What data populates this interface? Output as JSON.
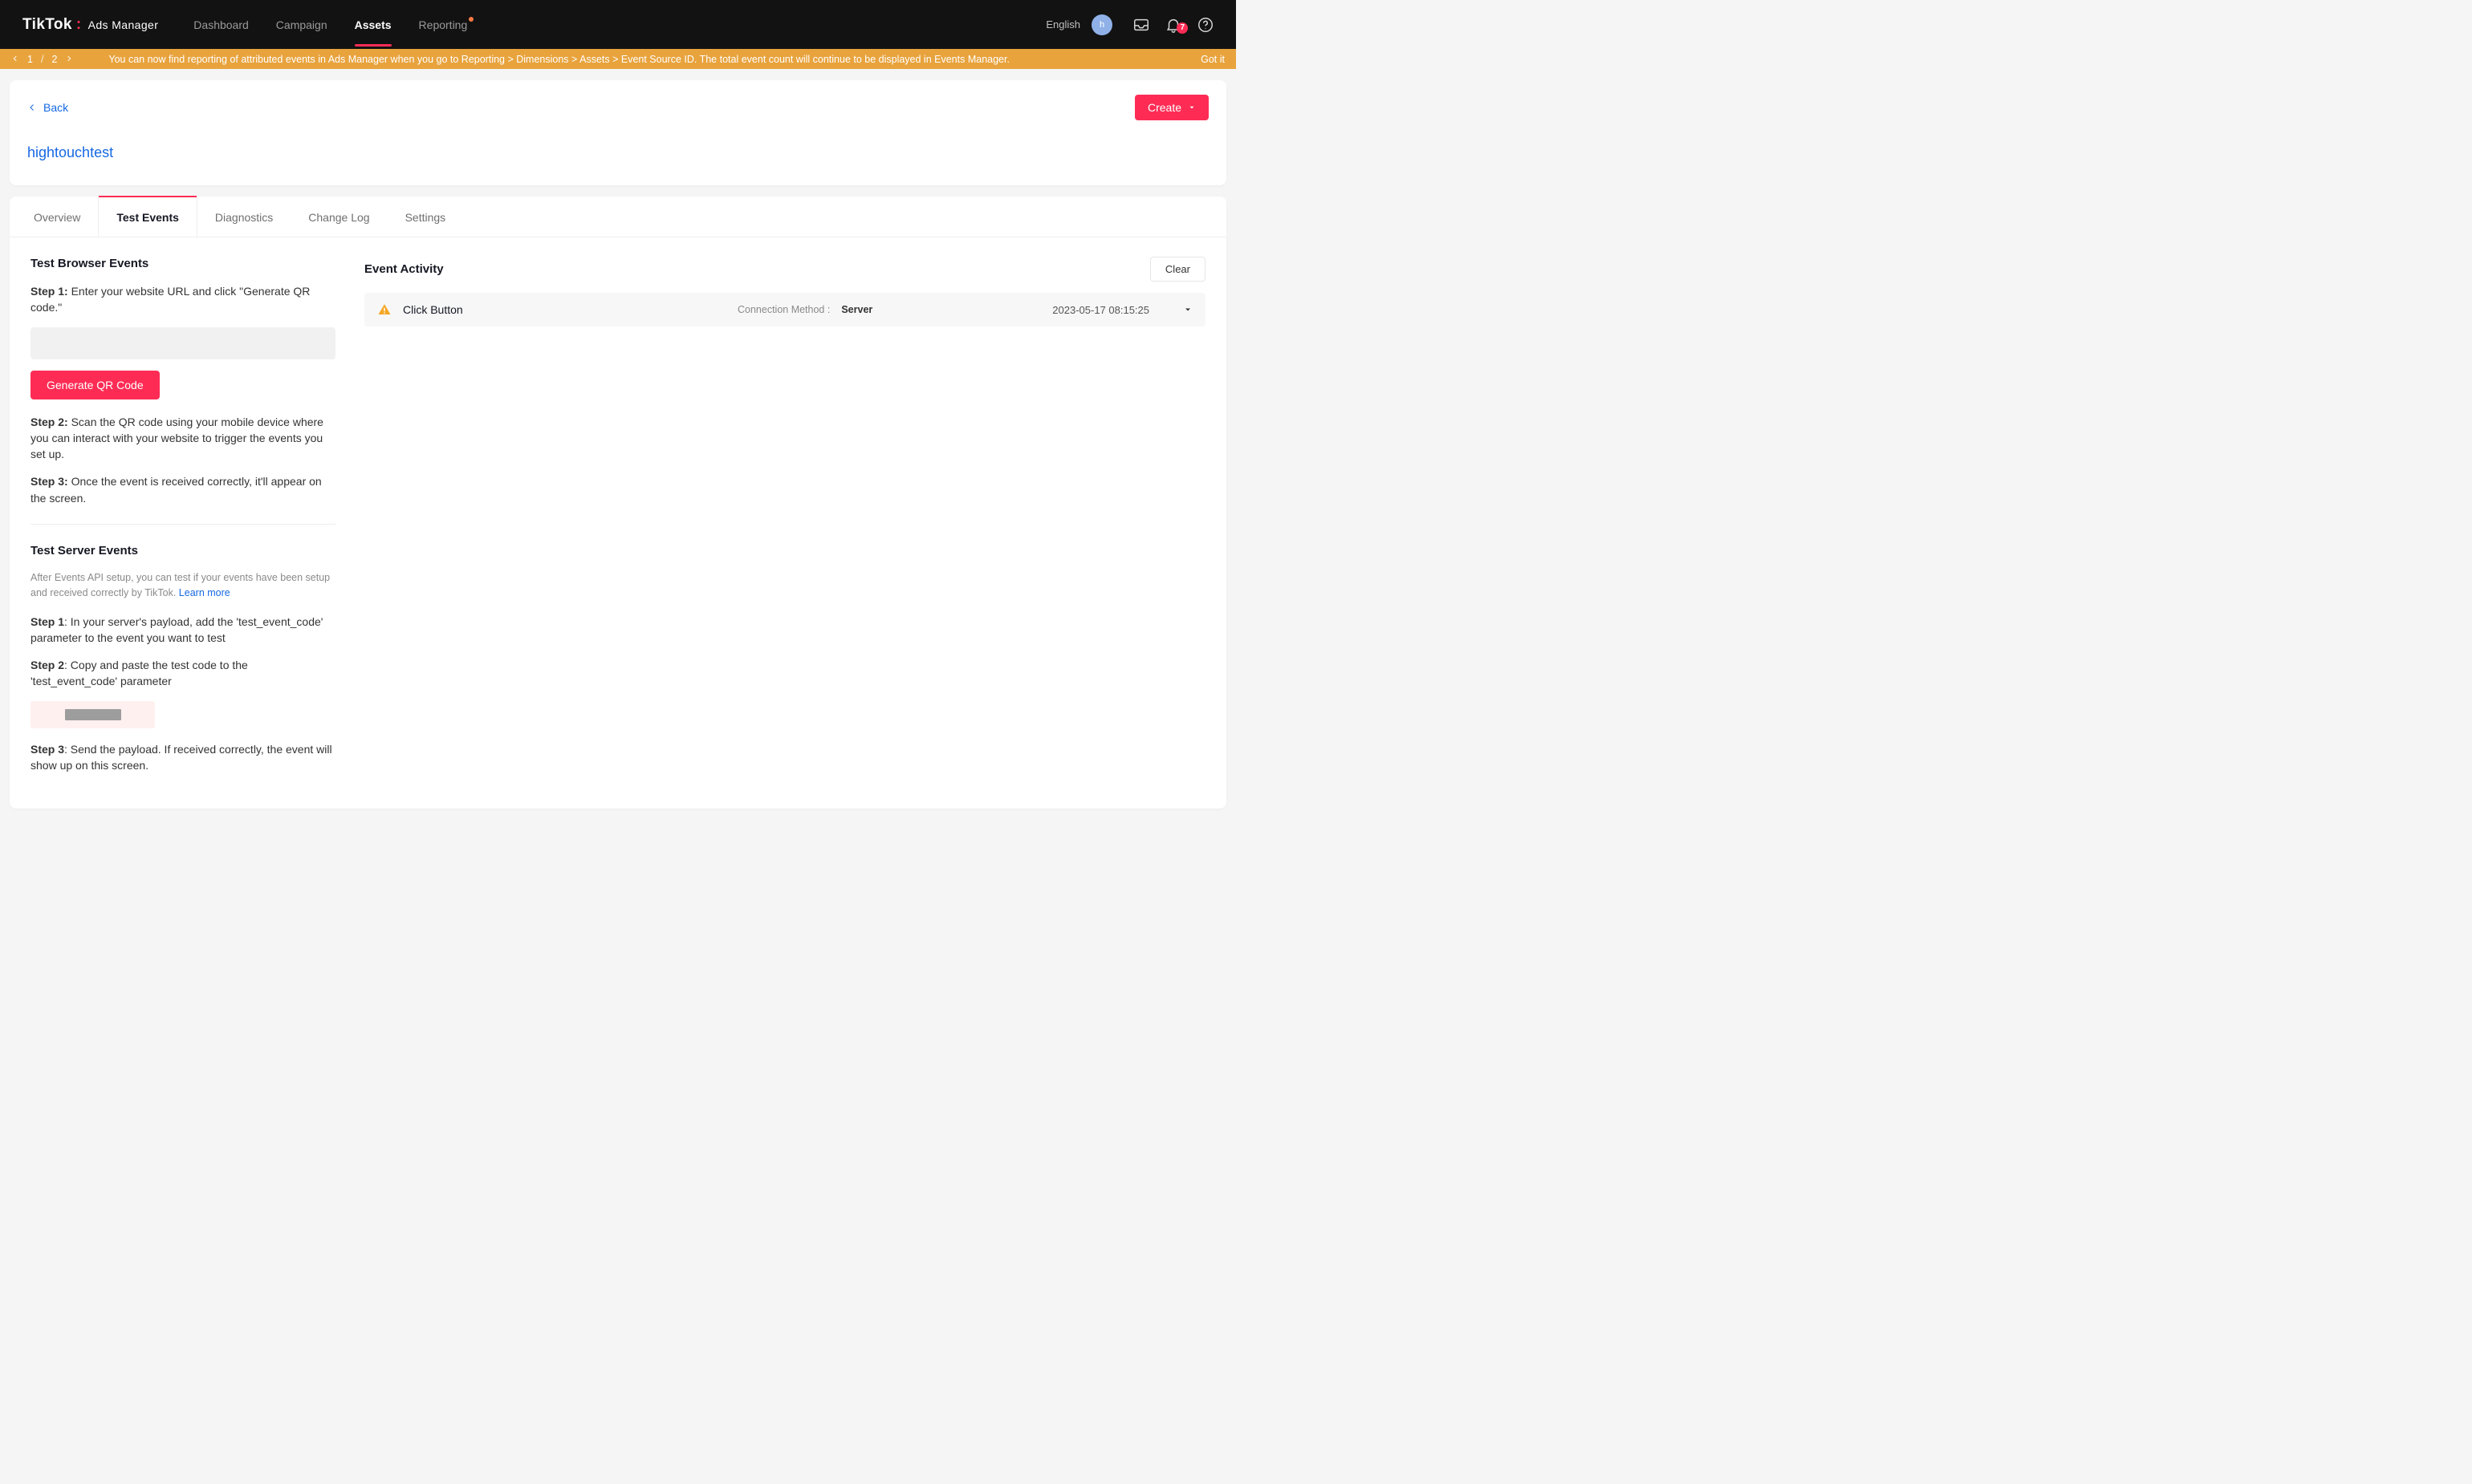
{
  "brand": {
    "primary": "TikTok",
    "sub": "Ads Manager"
  },
  "nav": [
    {
      "label": "Dashboard"
    },
    {
      "label": "Campaign"
    },
    {
      "label": "Assets",
      "active": true
    },
    {
      "label": "Reporting",
      "dot": true
    }
  ],
  "language": "English",
  "avatar_letter": "h",
  "notification_count": "7",
  "announce": {
    "page_current": "1",
    "page_total": "2",
    "text": "You can now find reporting of attributed events in Ads Manager when you go to Reporting > Dimensions > Assets > Event Source ID. The total event count will continue to be displayed in Events Manager.",
    "got_it": "Got it"
  },
  "header": {
    "back": "Back",
    "entity": "hightouchtest",
    "create": "Create"
  },
  "tabs": [
    {
      "label": "Overview"
    },
    {
      "label": "Test Events",
      "active": true
    },
    {
      "label": "Diagnostics"
    },
    {
      "label": "Change Log"
    },
    {
      "label": "Settings"
    }
  ],
  "browser_section": {
    "title": "Test Browser Events",
    "step1_label": "Step 1: ",
    "step1_text": "Enter your website URL and click \"Generate QR code.\"",
    "generate_btn": "Generate QR Code",
    "step2_label": "Step 2: ",
    "step2_text": "Scan the QR code using your mobile device where you can interact with your website to trigger the events you set up.",
    "step3_label": "Step 3: ",
    "step3_text": "Once the event is received correctly, it'll appear on the screen."
  },
  "server_section": {
    "title": "Test Server Events",
    "desc": "After Events API setup, you can test if your events have been setup and received correctly by TikTok. ",
    "learn_more": "Learn more",
    "step1_label": "Step 1",
    "step1_text": ": In your server's payload, add the 'test_event_code' parameter to the event you want to test",
    "step2_label": "Step 2",
    "step2_text": ": Copy and paste the test code to the 'test_event_code' parameter",
    "step3_label": "Step 3",
    "step3_text": ": Send the payload. If received correctly, the event will show up on this screen."
  },
  "activity": {
    "title": "Event Activity",
    "clear": "Clear",
    "events": [
      {
        "name": "Click Button",
        "conn_label": "Connection Method : ",
        "conn_value": "Server",
        "time": "2023-05-17 08:15:25"
      }
    ]
  }
}
